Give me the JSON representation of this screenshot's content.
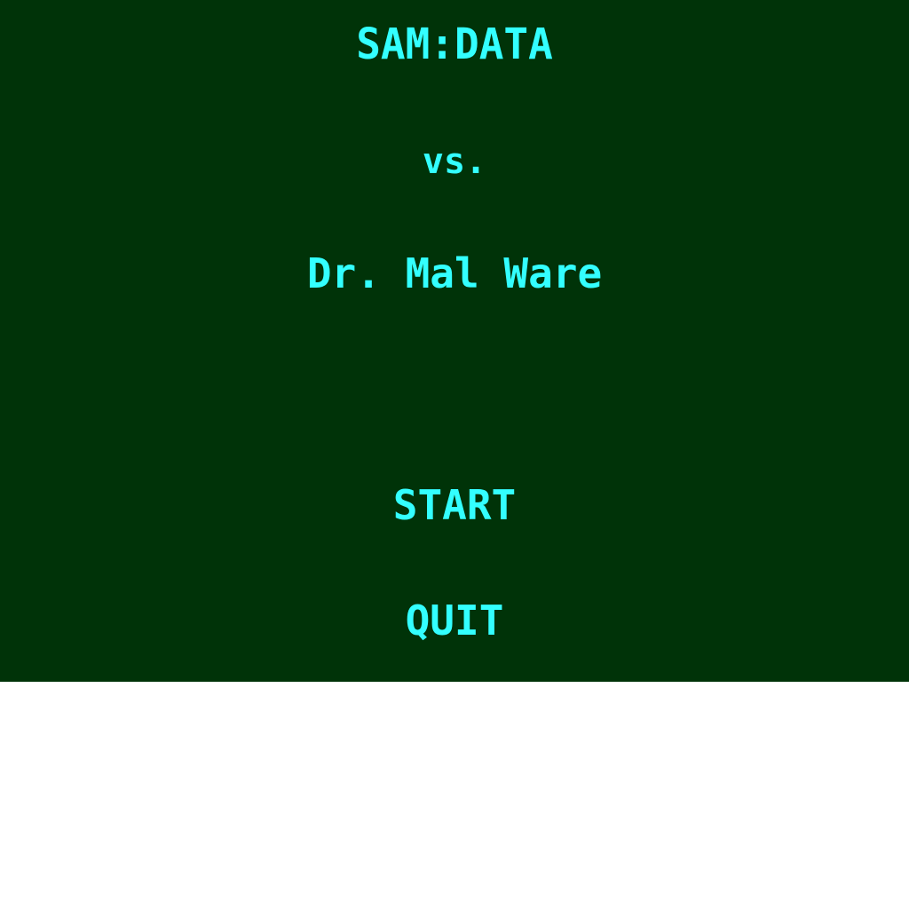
{
  "game": {
    "title": "SAM:DATA",
    "versus": "vs.",
    "villain": "Dr. Mal Ware"
  },
  "menu": {
    "start_label": "START",
    "quit_label": "QUIT"
  },
  "colors": {
    "background": "#003308",
    "text": "#33ffff",
    "outside": "#ffffff"
  }
}
